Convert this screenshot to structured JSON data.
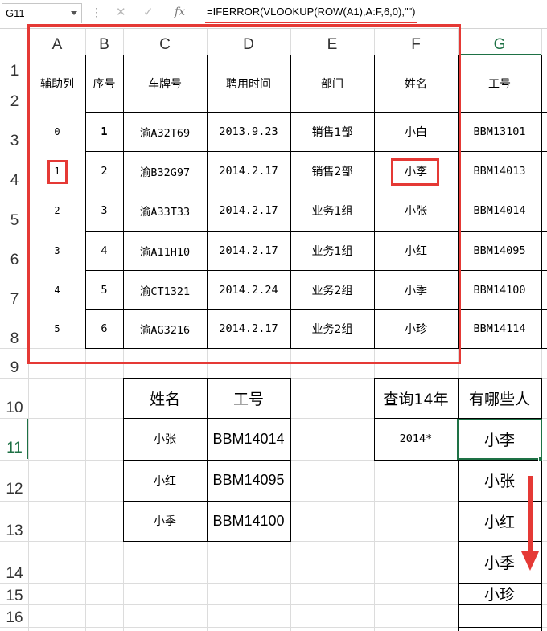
{
  "formula_bar": {
    "name_box": "G11",
    "dots_icon": "⋮",
    "cancel_icon": "✕",
    "enter_icon": "✓",
    "fx_label": "fx",
    "formula": "=IFERROR(VLOOKUP(ROW(A1),A:F,6,0),\"\")"
  },
  "columns": [
    "A",
    "B",
    "C",
    "D",
    "E",
    "F",
    "G"
  ],
  "rows": [
    "1",
    "2",
    "3",
    "4",
    "5",
    "6",
    "7",
    "8",
    "9",
    "10",
    "11",
    "12",
    "13",
    "14",
    "15",
    "16"
  ],
  "selected_cell": "G11",
  "main_table": {
    "headers": [
      "辅助列",
      "序号",
      "车牌号",
      "聘用时间",
      "部门",
      "姓名",
      "工号"
    ],
    "rows": [
      [
        "0",
        "1",
        "渝A32T69",
        "2013.9.23",
        "销售1部",
        "小白",
        "BBM13101"
      ],
      [
        "1",
        "2",
        "渝B32G97",
        "2014.2.17",
        "销售2部",
        "小李",
        "BBM14013"
      ],
      [
        "2",
        "3",
        "渝A33T33",
        "2014.2.17",
        "业务1组",
        "小张",
        "BBM14014"
      ],
      [
        "3",
        "4",
        "渝A11H10",
        "2014.2.17",
        "业务1组",
        "小红",
        "BBM14095"
      ],
      [
        "4",
        "5",
        "渝CT1321",
        "2014.2.24",
        "业务2组",
        "小季",
        "BBM14100"
      ],
      [
        "5",
        "6",
        "渝AG3216",
        "2014.2.17",
        "业务2组",
        "小珍",
        "BBM14114"
      ]
    ]
  },
  "lookup_table": {
    "headers": [
      "姓名",
      "工号"
    ],
    "rows": [
      [
        "小张",
        "BBM14014"
      ],
      [
        "小红",
        "BBM14095"
      ],
      [
        "小季",
        "BBM14100"
      ]
    ]
  },
  "query": {
    "label": "查询14年",
    "value": "2014*"
  },
  "results": {
    "header": "有哪些人",
    "values": [
      "小李",
      "小张",
      "小红",
      "小季",
      "小珍"
    ]
  },
  "colors": {
    "annotation_red": "#e53935",
    "excel_green": "#1e7145",
    "gridline": "#dcdcdc"
  }
}
